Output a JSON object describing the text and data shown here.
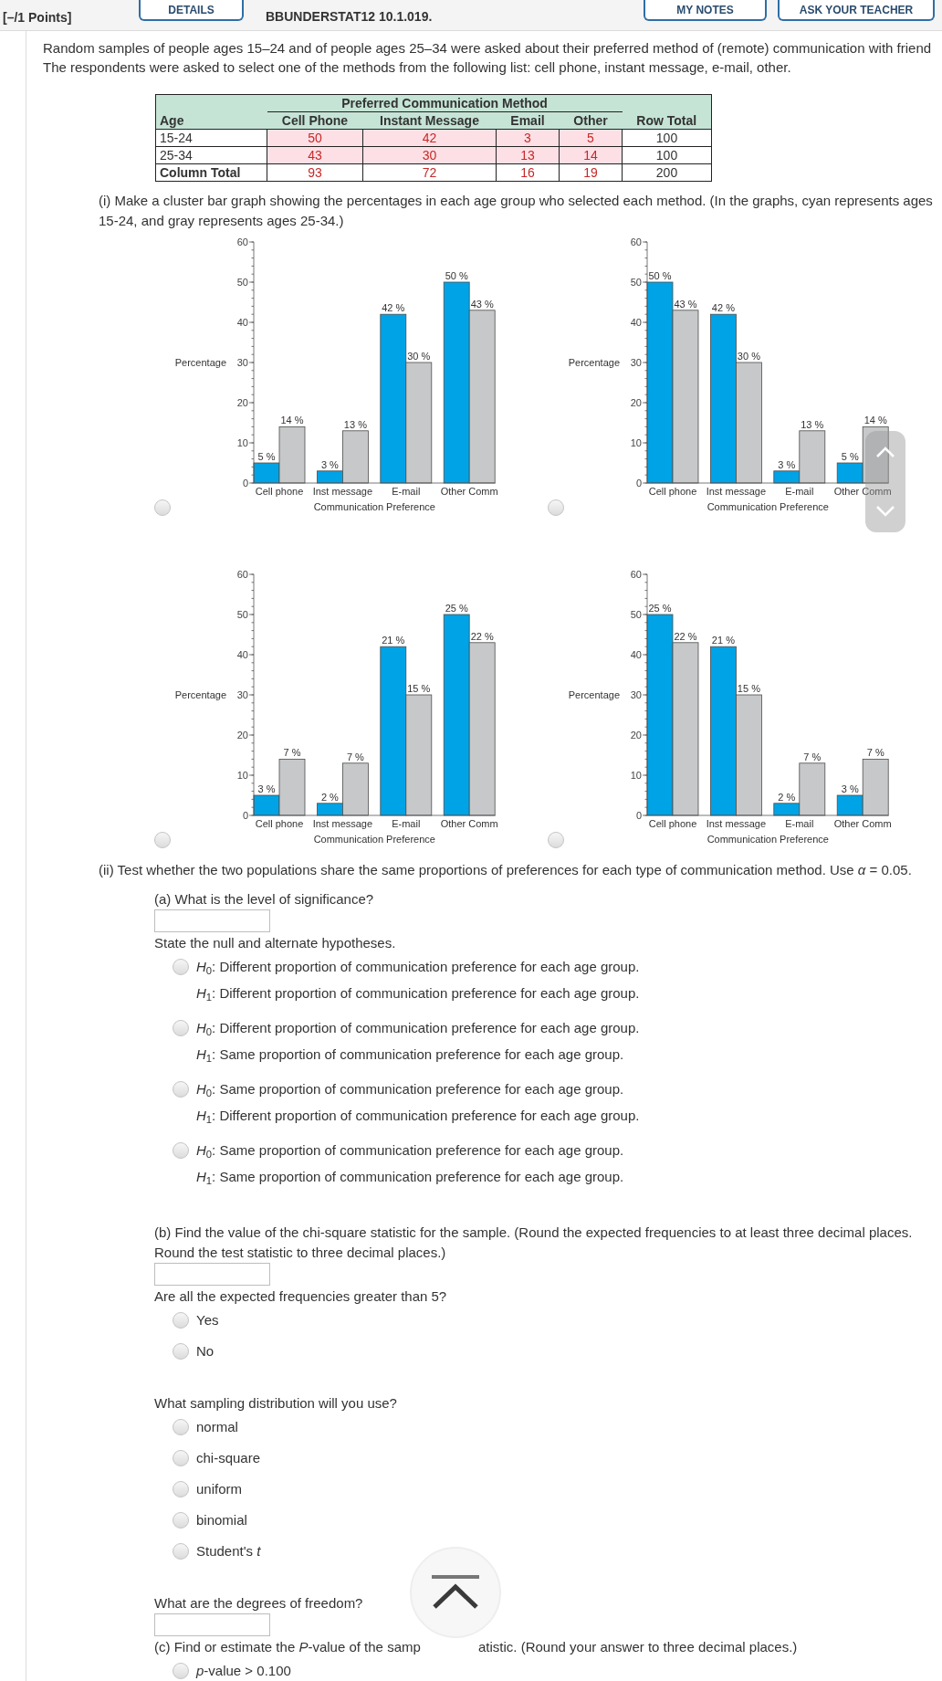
{
  "header": {
    "points": "[–/1 Points]",
    "details_button": "DETAILS",
    "problem_id": "BBUNDERSTAT12 10.1.019.",
    "notes_button": "MY NOTES",
    "ask_button": "ASK YOUR TEACHER"
  },
  "intro": {
    "lines": [
      "Random samples of people ages 15–24 and of people ages 25–34 were asked about their preferred method of (remote) communication with friend",
      "The respondents were asked to select one of the methods from the following list: cell phone, instant message, e-mail, other."
    ]
  },
  "table": {
    "group_header": "Preferred Communication Method",
    "columns": [
      "Age",
      "Cell Phone",
      "Instant Message",
      "Email",
      "Other",
      "Row Total"
    ],
    "rows": [
      {
        "kind": "data",
        "cells": [
          "15-24",
          "50",
          "42",
          "3",
          "5",
          "100"
        ]
      },
      {
        "kind": "data",
        "cells": [
          "25-34",
          "43",
          "30",
          "13",
          "14",
          "100"
        ]
      },
      {
        "kind": "total",
        "cells": [
          "Column Total",
          "93",
          "72",
          "16",
          "19",
          "200"
        ]
      }
    ]
  },
  "part_i": {
    "lines": [
      "(i) Make a cluster bar graph showing the percentages in each age group who selected each method. (In the graphs, cyan represents ages",
      "15-24, and gray represents ages 25-34.)"
    ],
    "charts": [
      {
        "selected": false,
        "chart_data": {
          "type": "bar",
          "xlabel": "Communication Preference",
          "ylabel": "Percentage",
          "categories": [
            "Cell phone",
            "Inst message",
            "E-mail",
            "Other Comm"
          ],
          "series": [
            {
              "color": "#00a3e6",
              "values": [
                5,
                3,
                42,
                50
              ],
              "value_labels": [
                "5 %",
                "3 %",
                "42 %",
                "50 %"
              ]
            },
            {
              "color": "#c7c8ca",
              "values": [
                14,
                13,
                30,
                43
              ],
              "value_labels": [
                "14 %",
                "13 %",
                "30 %",
                "43 %"
              ]
            }
          ],
          "ylim": [
            0,
            60
          ],
          "yticks": [
            {
              "value": 0,
              "label": "0"
            },
            {
              "value": 10,
              "label": "10"
            },
            {
              "value": 20,
              "label": "20"
            },
            {
              "value": 30,
              "label": "30"
            },
            {
              "value": 40,
              "label": "40"
            },
            {
              "value": 50,
              "label": "50"
            },
            {
              "value": 60,
              "label": "60"
            }
          ]
        }
      },
      {
        "selected": false,
        "chart_data": {
          "type": "bar",
          "xlabel": "Communication Preference",
          "ylabel": "Percentage",
          "categories": [
            "Cell phone",
            "Inst message",
            "E-mail",
            "Other Comm"
          ],
          "series": [
            {
              "color": "#00a3e6",
              "values": [
                50,
                42,
                3,
                5
              ],
              "value_labels": [
                "50 %",
                "42 %",
                "3 %",
                "5 %"
              ]
            },
            {
              "color": "#c7c8ca",
              "values": [
                43,
                30,
                13,
                14
              ],
              "value_labels": [
                "43 %",
                "30 %",
                "13 %",
                "14 %"
              ]
            }
          ],
          "ylim": [
            0,
            60
          ],
          "yticks": [
            {
              "value": 0,
              "label": "0"
            },
            {
              "value": 10,
              "label": "10"
            },
            {
              "value": 20,
              "label": "20"
            },
            {
              "value": 30,
              "label": "30"
            },
            {
              "value": 40,
              "label": "40"
            },
            {
              "value": 50,
              "label": "50"
            },
            {
              "value": 60,
              "label": "60"
            }
          ]
        }
      },
      {
        "selected": false,
        "chart_data": {
          "type": "bar",
          "xlabel": "Communication Preference",
          "ylabel": "Percentage",
          "categories": [
            "Cell phone",
            "Inst message",
            "E-mail",
            "Other Comm"
          ],
          "series": [
            {
              "color": "#00a3e6",
              "values": [
                5,
                3,
                42,
                50
              ]
            },
            {
              "color": "#c7c8ca",
              "values": [
                14,
                13,
                30,
                43
              ]
            }
          ],
          "ylim": [
            0,
            60
          ],
          "yticks": [
            {
              "value": 0,
              "label": "0"
            },
            {
              "value": 10,
              "label": "10"
            },
            {
              "value": 20,
              "label": "20"
            },
            {
              "value": 30,
              "label": "30"
            },
            {
              "value": 40,
              "label": "40"
            },
            {
              "value": 50,
              "label": "50"
            },
            {
              "value": 60,
              "label": "60"
            }
          ],
          "annotations": [
            {
              "x": "Cell phone",
              "y": 5,
              "text": "3 %"
            },
            {
              "x": "Inst message",
              "y": 3,
              "text": "2 %"
            },
            {
              "x": "E-mail",
              "y": 42,
              "text": "21 %"
            },
            {
              "x": "Other Comm",
              "y": 50,
              "text": "25 %"
            },
            {
              "x": "Cell phone",
              "y": 14,
              "text": "7 %"
            },
            {
              "x": "Inst message",
              "y": 13,
              "text": "7 %"
            },
            {
              "x": "E-mail",
              "y": 30,
              "text": "15 %"
            },
            {
              "x": "Other Comm",
              "y": 43,
              "text": "22 %"
            }
          ]
        }
      },
      {
        "selected": false,
        "chart_data": {
          "type": "bar",
          "xlabel": "Communication Preference",
          "ylabel": "Percentage",
          "categories": [
            "Cell phone",
            "Inst message",
            "E-mail",
            "Other Comm"
          ],
          "series": [
            {
              "color": "#00a3e6",
              "values": [
                50,
                42,
                3,
                5
              ]
            },
            {
              "color": "#c7c8ca",
              "values": [
                43,
                30,
                13,
                14
              ]
            }
          ],
          "ylim": [
            0,
            60
          ],
          "yticks": [
            {
              "value": 0,
              "label": "0"
            },
            {
              "value": 10,
              "label": "10"
            },
            {
              "value": 20,
              "label": "20"
            },
            {
              "value": 30,
              "label": "30"
            },
            {
              "value": 40,
              "label": "40"
            },
            {
              "value": 50,
              "label": "50"
            },
            {
              "value": 60,
              "label": "60"
            }
          ],
          "annotations": [
            {
              "x": "Cell phone",
              "y": 50,
              "text": "25 %"
            },
            {
              "x": "Inst message",
              "y": 42,
              "text": "21 %"
            },
            {
              "x": "E-mail",
              "y": 3,
              "text": "2 %"
            },
            {
              "x": "Other Comm",
              "y": 5,
              "text": "3 %"
            },
            {
              "x": "Cell phone",
              "y": 43,
              "text": "22 %"
            },
            {
              "x": "Inst message",
              "y": 30,
              "text": "15 %"
            },
            {
              "x": "E-mail",
              "y": 13,
              "text": "7 %"
            },
            {
              "x": "Other Comm",
              "y": 14,
              "text": "7 %"
            }
          ]
        }
      }
    ]
  },
  "part_ii": {
    "text": "(ii) Test whether the two populations share the same proportions of preferences for each type of communication method. Use *α* = 0.05.",
    "questions": [
      {
        "kind": "input",
        "prompt": [
          "(a) What is the level of significance?"
        ]
      },
      {
        "kind": "choice",
        "prompt": [
          "State the null and alternate hypotheses."
        ],
        "options": [
          {
            "selected": false,
            "lines": [
              "*H*$_{0}$: Different proportion of communication preference for each age group.",
              "*H*$_{1}$: Different proportion of communication preference for each age group."
            ]
          },
          {
            "selected": false,
            "lines": [
              "*H*$_{0}$: Different proportion of communication preference for each age group.",
              "*H*$_{1}$: Same proportion of communication preference for each age group."
            ]
          },
          {
            "selected": false,
            "lines": [
              "*H*$_{0}$: Same proportion of communication preference for each age group.",
              "*H*$_{1}$: Different proportion of communication preference for each age group."
            ]
          },
          {
            "selected": false,
            "lines": [
              "*H*$_{0}$: Same proportion of communication preference for each age group.",
              "*H*$_{1}$: Same proportion of communication preference for each age group."
            ]
          }
        ]
      },
      {
        "kind": "input",
        "prompt": [
          "(b) Find the value of the chi-square statistic for the sample. (Round the expected frequencies to at least three decimal places.",
          "Round the test statistic to three decimal places.)"
        ]
      },
      {
        "kind": "choice",
        "prompt": [
          "Are all the expected frequencies greater than 5?"
        ],
        "options": [
          {
            "selected": false,
            "lines": [
              "Yes"
            ]
          },
          {
            "selected": false,
            "lines": [
              "No"
            ]
          }
        ]
      },
      {
        "kind": "choice",
        "prompt": [
          "What sampling distribution will you use?"
        ],
        "options": [
          {
            "selected": false,
            "lines": [
              "normal"
            ]
          },
          {
            "selected": false,
            "lines": [
              "chi-square"
            ]
          },
          {
            "selected": false,
            "lines": [
              "uniform"
            ]
          },
          {
            "selected": false,
            "lines": [
              "binomial"
            ]
          },
          {
            "selected": false,
            "lines": [
              "Student's *t*"
            ]
          }
        ]
      },
      {
        "kind": "input",
        "prompt": [
          "What are the degrees of freedom?"
        ]
      },
      {
        "kind": "choice",
        "prompt_segments": [
          "(c) Find or estimate the *P*-value of the samp",
          "atistic. (Round your answer to three decimal places.)"
        ],
        "options": [
          {
            "selected": false,
            "lines": [
              "*p*-value > 0.100"
            ]
          }
        ]
      }
    ]
  }
}
